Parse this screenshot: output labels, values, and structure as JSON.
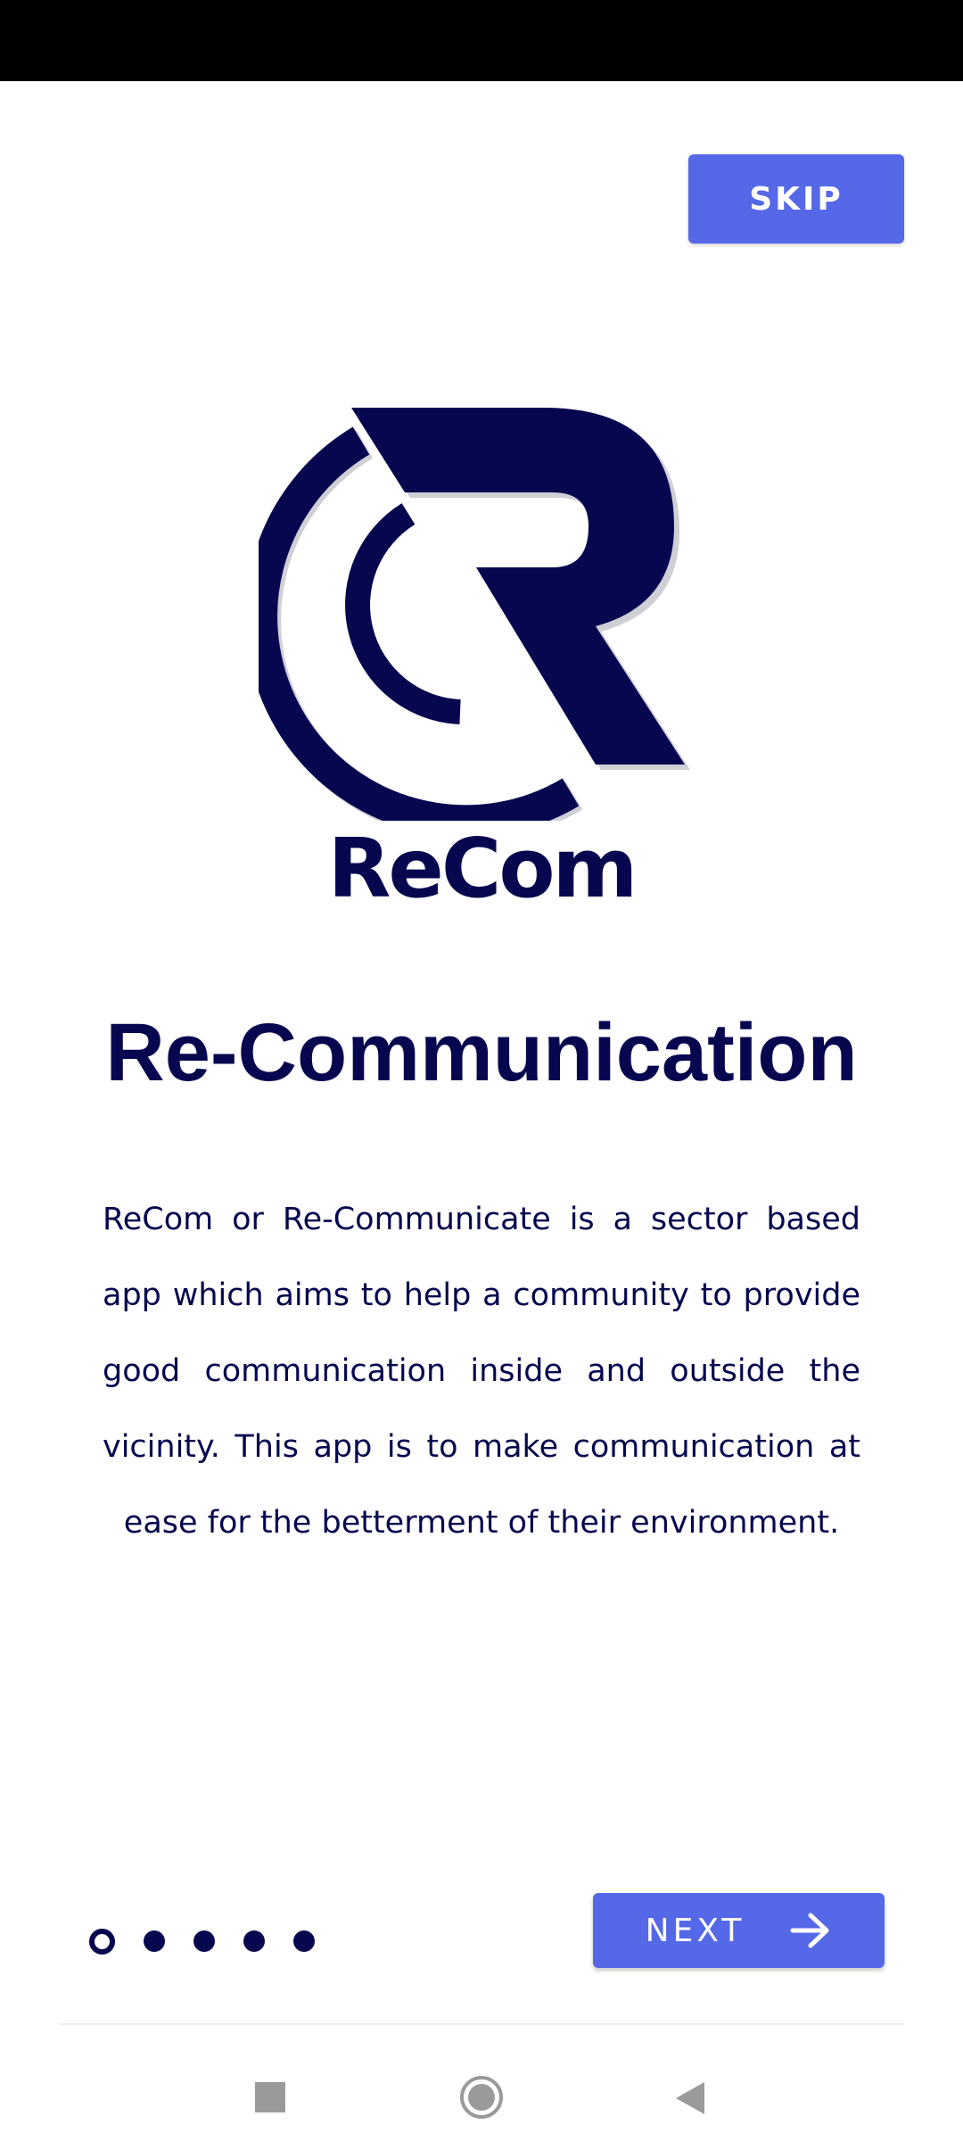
{
  "header": {
    "skip_label": "SKIP"
  },
  "logo": {
    "icon": "recom-logo-icon",
    "brand_name": "ReCom",
    "color": "#06074f"
  },
  "main": {
    "title": "Re-Communication",
    "description": "ReCom or Re-Communicate is a sector based app which aims to help a community to provide good communication inside and outside the vicinity. This app is to make communication at ease for the betterment of their environment."
  },
  "pager": {
    "total": 5,
    "current": 1
  },
  "footer": {
    "next_label": "NEXT",
    "next_icon": "arrow-right-icon"
  },
  "colors": {
    "accent": "#5468e8",
    "text": "#06074f",
    "status_bar": "#000000"
  },
  "system_nav": {
    "recent_icon": "square-icon",
    "home_icon": "circle-icon",
    "back_icon": "triangle-back-icon"
  }
}
